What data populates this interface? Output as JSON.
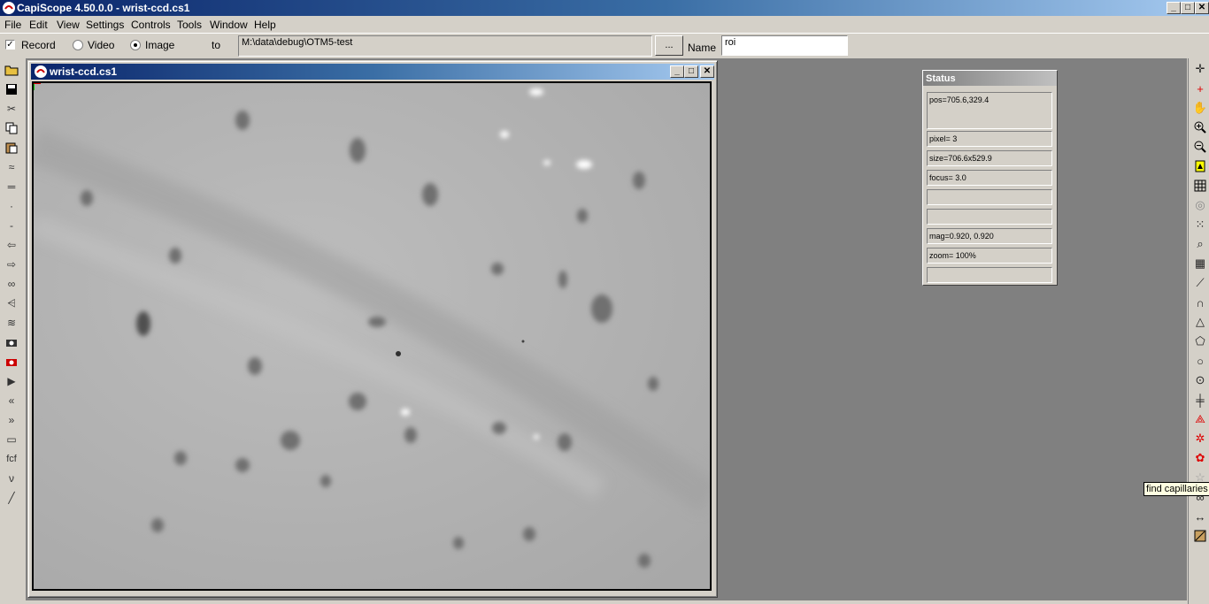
{
  "app": {
    "title": "CapiScope 4.50.0.0 - wrist-ccd.cs1",
    "min": "_",
    "max": "□",
    "close": "✕"
  },
  "menu": [
    "File",
    "Edit",
    "View",
    "Settings",
    "Controls",
    "Tools",
    "Window",
    "Help"
  ],
  "toolbar": {
    "record_checked": "✓",
    "record_label": "Record",
    "video_label": "Video",
    "image_label": "Image",
    "to_label": "to",
    "path_value": "M:\\data\\debug\\OTM5-test",
    "browse_label": "...",
    "name_label": "Name",
    "name_value": "roi"
  },
  "child_window": {
    "title": "wrist-ccd.cs1",
    "min": "_",
    "max": "□",
    "close": "✕"
  },
  "status": {
    "title": "Status",
    "pos": "pos=705.6,329.4",
    "pixel": "pixel=  3",
    "size": "size=706.6x529.9",
    "focus": "focus=  3.0",
    "empty1": "",
    "empty2": "",
    "mag": "mag=0.920, 0.920",
    "zoom": "zoom= 100%",
    "empty3": ""
  },
  "tooltip": "find capillaries",
  "left_tools": [
    "open-folder-icon",
    "save-icon",
    "cut-icon",
    "copy-icon",
    "paste-icon",
    "wave-icon",
    "equals-icon",
    "dot-icon",
    "dash-icon",
    "arrow-left-icon",
    "arrow-right-icon",
    "glasses-icon",
    "stairs-icon",
    "zigzag-icon",
    "camera-icon",
    "camera-red-icon",
    "play-icon",
    "rewind-icon",
    "fast-forward-icon",
    "film-icon",
    "fcf-icon",
    "nu-icon",
    "line-icon"
  ],
  "right_tools": [
    "crosshair-icon",
    "red-crosshair-icon",
    "hand-icon",
    "zoom-in-icon",
    "zoom-out-icon",
    "yellow-marker-icon",
    "grid-icon",
    "circle-grid-icon",
    "dots-icon",
    "find-icon",
    "barcode-icon",
    "line-tool-icon",
    "curve-tool-icon",
    "triangle-tool-icon",
    "polygon-tool-icon",
    "circle-tool-icon",
    "ellipse-tool-icon",
    "intersect-icon",
    "capillary-red-icon",
    "bug-red-icon",
    "find-capillaries-icon",
    "star-icon",
    "binoculars-icon",
    "double-arrow-icon",
    "image-map-icon"
  ],
  "colors": {
    "title_active_start": "#0a246a",
    "title_active_end": "#a6caf0",
    "face": "#d4d0c8",
    "workspace": "#808080",
    "tooltip_bg": "#ffffe1"
  }
}
